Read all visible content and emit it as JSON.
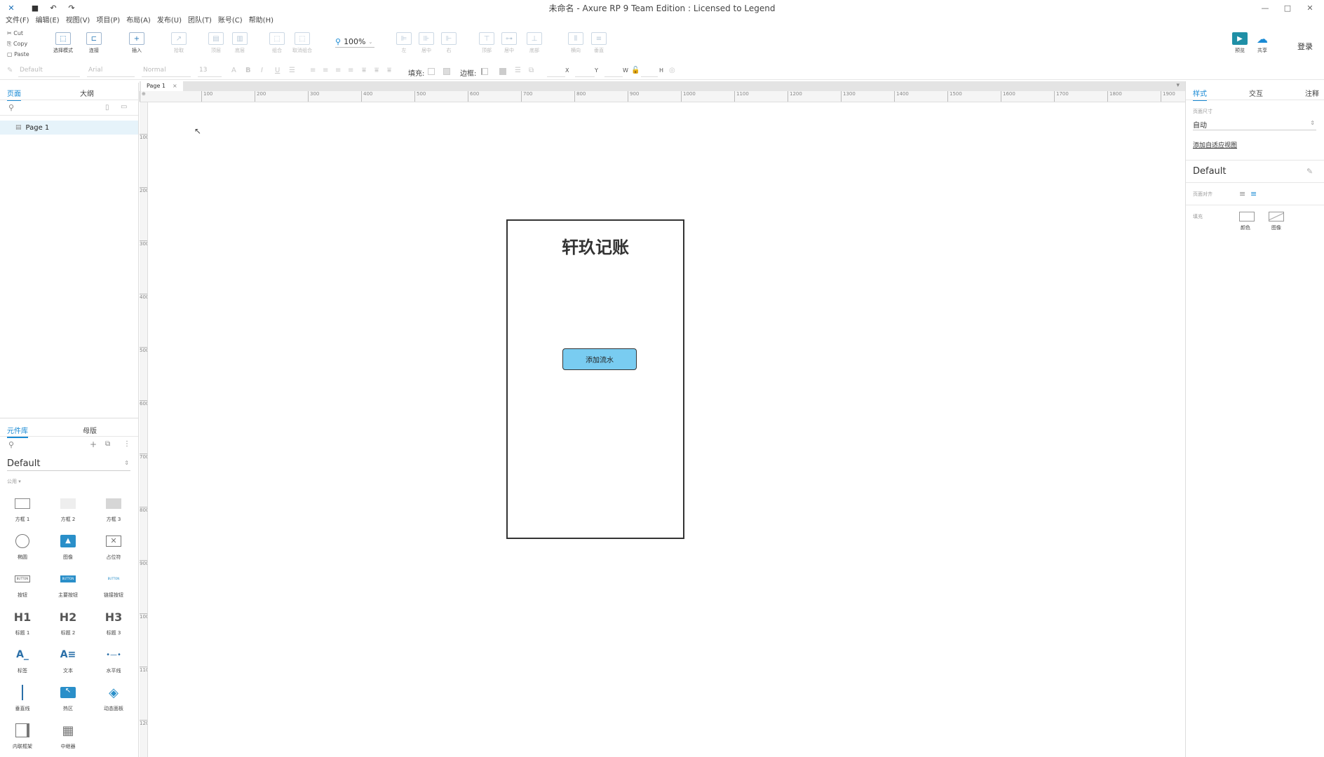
{
  "window": {
    "title": "未命名 - Axure RP 9 Team Edition : Licensed to Legend"
  },
  "menu": [
    "文件(F)",
    "编辑(E)",
    "视图(V)",
    "项目(P)",
    "布局(A)",
    "发布(U)",
    "团队(T)",
    "账号(C)",
    "帮助(H)"
  ],
  "clipboard": {
    "cut": "Cut",
    "copy": "Copy",
    "paste": "Paste"
  },
  "toolbar": {
    "select_mode": "选择模式",
    "connect": "连接",
    "insert": "插入",
    "point": "拾取",
    "top": "顶层",
    "bottom": "底层",
    "group": "组合",
    "ungroup": "取消组合",
    "zoom": "100%",
    "left": "左",
    "center": "居中",
    "right": "右",
    "top_align": "顶部",
    "middle": "居中",
    "bottom_align": "底部",
    "horizontal": "横向",
    "vertical": "垂直",
    "preview": "预览",
    "share": "共享",
    "login": "登录"
  },
  "format": {
    "style": "Default",
    "font": "Arial",
    "weight": "Normal",
    "size": "13",
    "fill_label": "填充:",
    "border_label": "边框:",
    "x": "X",
    "y": "Y",
    "w": "W",
    "h": "H"
  },
  "pages_panel": {
    "tab_pages": "页面",
    "tab_outline": "大纲",
    "page1": "Page 1"
  },
  "library_panel": {
    "tab_library": "元件库",
    "tab_masters": "母版",
    "library_name": "Default",
    "category": "公用 ▾",
    "items": {
      "box1": "方框 1",
      "box2": "方框 2",
      "box3": "方框 3",
      "ellipse": "椭圆",
      "image": "图像",
      "placeholder": "占位符",
      "button": "按钮",
      "primary_button": "主要按钮",
      "link_button": "链接按钮",
      "h1": "标题 1",
      "h2": "标题 2",
      "h3": "标题 3",
      "label": "标签",
      "text": "文本",
      "hline": "水平线",
      "vline": "垂直线",
      "hotspot": "热区",
      "dynamic_panel": "动态面板",
      "inline_frame": "内联框架",
      "repeater": "中继器"
    },
    "button_caption": "BUTTON",
    "glyph_h1": "H1",
    "glyph_h2": "H2",
    "glyph_h3": "H3"
  },
  "canvas": {
    "tab": "Page 1",
    "tab_close": "×",
    "ruler_h": [
      "100",
      "200",
      "300",
      "400",
      "500",
      "600",
      "700",
      "800",
      "900",
      "1000",
      "1100",
      "1200",
      "1300",
      "1400",
      "1500",
      "1600",
      "1700",
      "1800",
      "1900"
    ],
    "ruler_v": [
      "100",
      "200",
      "300",
      "400",
      "500",
      "600",
      "700",
      "800",
      "900",
      "1000",
      "1100",
      "1200"
    ],
    "app_title": "轩玖记账",
    "button_label": "添加流水"
  },
  "right_panel": {
    "tab_style": "样式",
    "tab_interaction": "交互",
    "tab_notes": "注释",
    "page_size_label": "页面尺寸",
    "page_size_value": "自动",
    "adaptive_link": "添加自适应视图",
    "style_name": "Default",
    "align_label": "页面对齐",
    "fill_label": "填充",
    "fill_color": "颜色",
    "fill_image": "图像"
  },
  "colors": {
    "accent": "#1a8ad4",
    "button_fill": "#79ccf1"
  }
}
